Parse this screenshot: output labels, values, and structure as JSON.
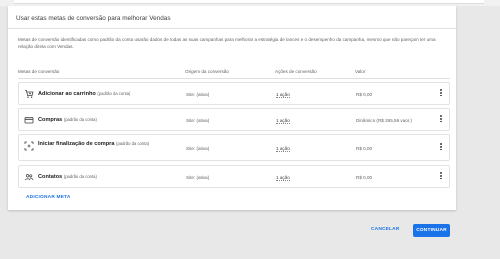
{
  "card": {
    "title": "Usar estas metas de conversão para melhorar Vendas",
    "description": "Metas de conversão identificadas como padrão da conta usarão dados de todas as suas campanhas para melhorar a estratégia de lances e o desempenho da campanha, mesmo que não pareçam ter uma relação direta com Vendas."
  },
  "table": {
    "headers": {
      "goal": "Metas de conversão",
      "origin": "Origem da conversão",
      "actions": "Ações de conversão",
      "value": "Valor"
    },
    "rows": [
      {
        "name": "Adicionar ao carrinho",
        "suffix": "(padrão da conta)",
        "icon": "cart-add-icon",
        "origin": "Site: (ativa)",
        "action": "1 ação",
        "value": "R$ 0,00"
      },
      {
        "name": "Compras",
        "suffix": "(padrão da conta)",
        "icon": "credit-card-icon",
        "origin": "Site: (ativa)",
        "action": "1 ação",
        "value": "Dinâmico (R$ 265,56 vaor.)"
      },
      {
        "name": "Iniciar finalização de compra",
        "suffix": "(padrão da conta)",
        "icon": "checkout-scan-icon",
        "origin": "Site: (ativa)",
        "action": "1 ação",
        "value": "R$ 0,00"
      },
      {
        "name": "Contatos",
        "suffix": "(padrão da conta)",
        "icon": "contacts-icon",
        "origin": "Site: (ativa)",
        "action": "1 ação",
        "value": "R$ 0,00"
      }
    ]
  },
  "add_goal_label": "ADICIONAR META",
  "footer": {
    "cancel_label": "CANCELAR",
    "continue_label": "CONTINUAR"
  },
  "colors": {
    "accent": "#1a73e8",
    "background": "#e8e8e8",
    "card": "#ffffff"
  }
}
